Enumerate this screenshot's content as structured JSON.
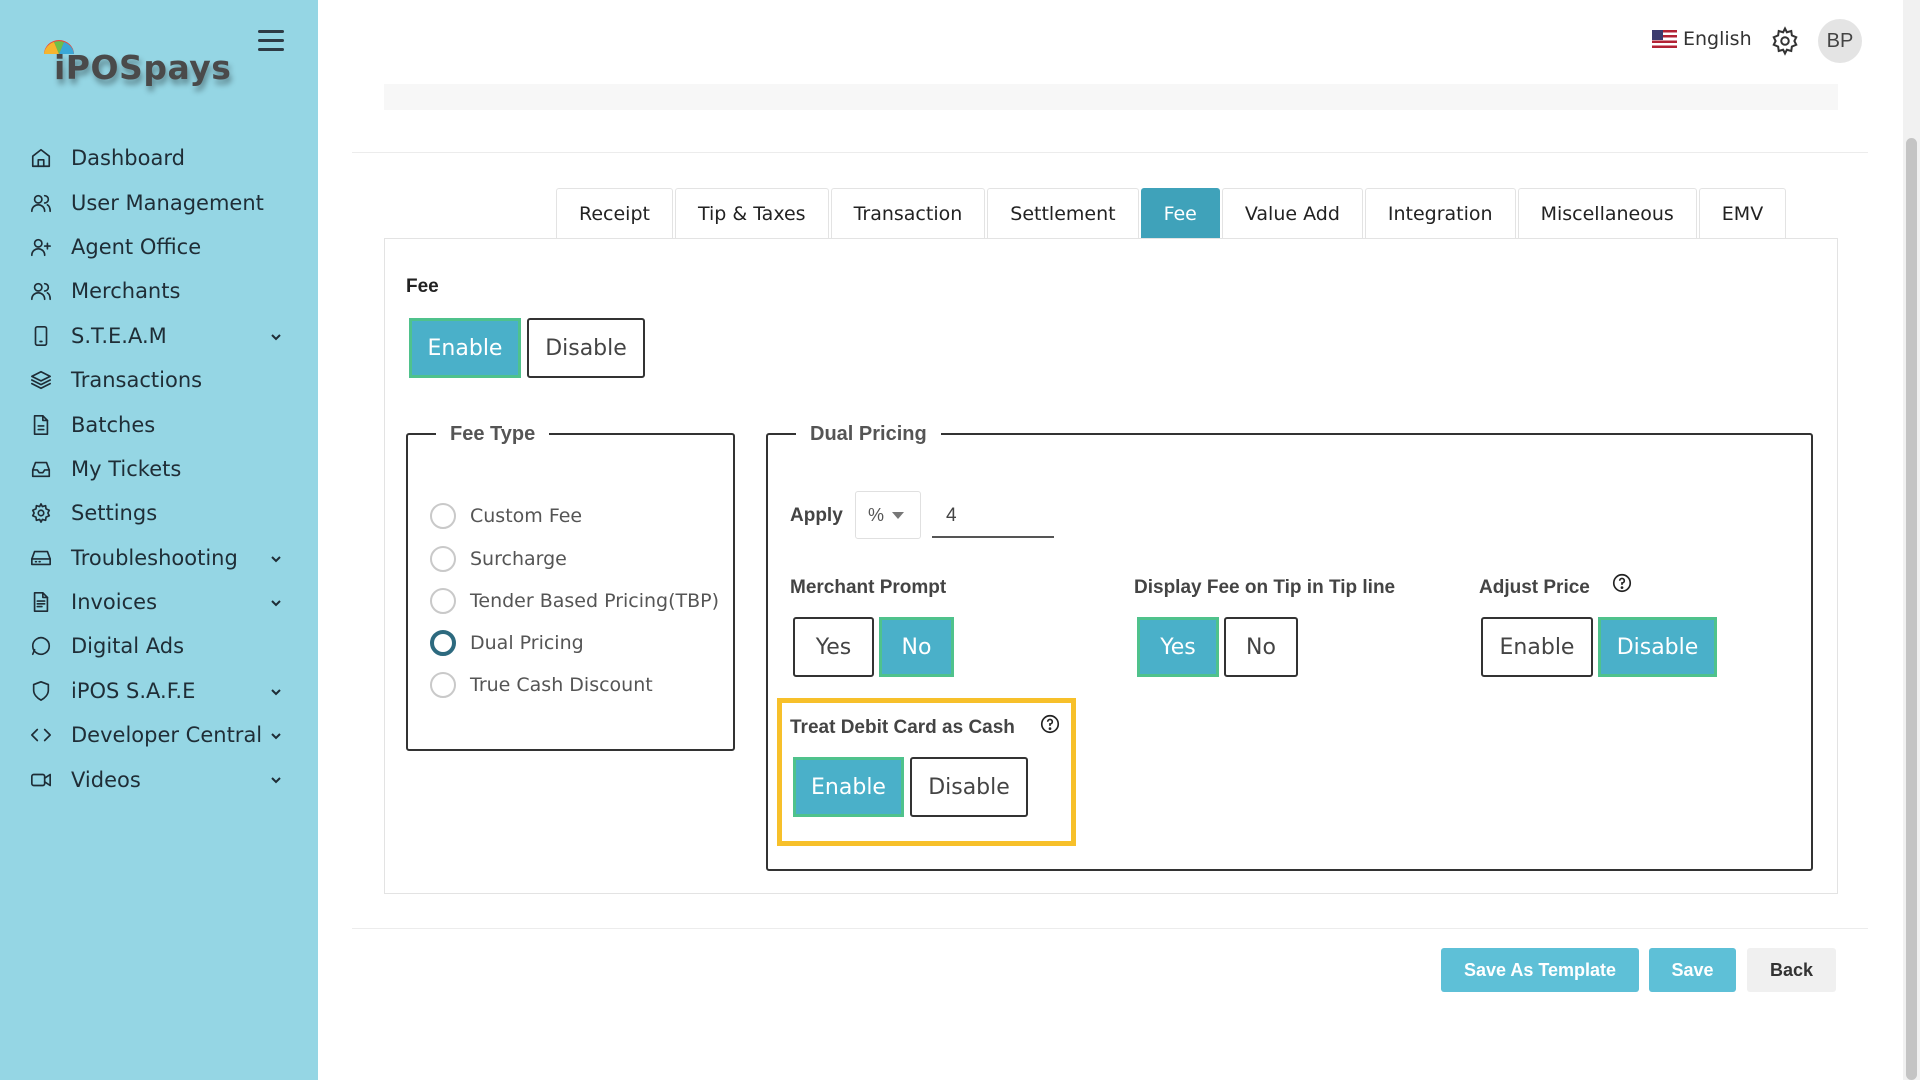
{
  "brand": {
    "logo_text": "iPOSpays"
  },
  "sidebar": {
    "items": [
      {
        "label": "Dashboard",
        "icon": "home-icon",
        "expandable": false
      },
      {
        "label": "User Management",
        "icon": "users-icon",
        "expandable": false
      },
      {
        "label": "Agent Office",
        "icon": "user-plus-icon",
        "expandable": false
      },
      {
        "label": "Merchants",
        "icon": "users-icon",
        "expandable": false
      },
      {
        "label": "S.T.E.A.M",
        "icon": "phone-icon",
        "expandable": true
      },
      {
        "label": "Transactions",
        "icon": "layers-icon",
        "expandable": false
      },
      {
        "label": "Batches",
        "icon": "file-icon",
        "expandable": false
      },
      {
        "label": "My Tickets",
        "icon": "inbox-icon",
        "expandable": false
      },
      {
        "label": "Settings",
        "icon": "gear-icon",
        "expandable": false
      },
      {
        "label": "Troubleshooting",
        "icon": "hard-drive-icon",
        "expandable": true
      },
      {
        "label": "Invoices",
        "icon": "file-text-icon",
        "expandable": true
      },
      {
        "label": "Digital Ads",
        "icon": "message-circle-icon",
        "expandable": false
      },
      {
        "label": "iPOS S.A.F.E",
        "icon": "shield-icon",
        "expandable": true
      },
      {
        "label": "Developer Central",
        "icon": "code-icon",
        "expandable": true
      },
      {
        "label": "Videos",
        "icon": "video-icon",
        "expandable": true
      }
    ]
  },
  "header": {
    "language": "English",
    "avatar_initials": "BP"
  },
  "tabs": [
    {
      "label": "Receipt",
      "active": false
    },
    {
      "label": "Tip & Taxes",
      "active": false
    },
    {
      "label": "Transaction",
      "active": false
    },
    {
      "label": "Settlement",
      "active": false
    },
    {
      "label": "Fee",
      "active": true
    },
    {
      "label": "Value Add",
      "active": false
    },
    {
      "label": "Integration",
      "active": false
    },
    {
      "label": "Miscellaneous",
      "active": false
    },
    {
      "label": "EMV",
      "active": false
    }
  ],
  "fee": {
    "label": "Fee",
    "enable_label": "Enable",
    "disable_label": "Disable",
    "selected": "Enable"
  },
  "fee_type": {
    "legend": "Fee Type",
    "options": [
      "Custom Fee",
      "Surcharge",
      "Tender Based Pricing(TBP)",
      "Dual Pricing",
      "True Cash Discount"
    ],
    "selected": "Dual Pricing"
  },
  "dual_pricing": {
    "legend": "Dual Pricing",
    "apply_label": "Apply",
    "apply_unit": "%",
    "apply_value": "4",
    "merchant_prompt": {
      "label": "Merchant Prompt",
      "yes": "Yes",
      "no": "No",
      "selected": "No"
    },
    "display_fee_tip": {
      "label": "Display Fee on Tip in Tip line",
      "yes": "Yes",
      "no": "No",
      "selected": "Yes"
    },
    "adjust_price": {
      "label": "Adjust Price",
      "enable": "Enable",
      "disable": "Disable",
      "selected": "Disable"
    },
    "treat_debit": {
      "label": "Treat Debit Card as Cash",
      "enable": "Enable",
      "disable": "Disable",
      "selected": "Enable"
    }
  },
  "actions": {
    "save_template": "Save As Template",
    "save": "Save",
    "back": "Back"
  },
  "colors": {
    "sidebar_bg": "#95d6e4",
    "accent": "#4ab0c9",
    "active_tab": "#3fa2ba",
    "toggle_border": "#4fc28c",
    "highlight": "#f7c02a"
  }
}
